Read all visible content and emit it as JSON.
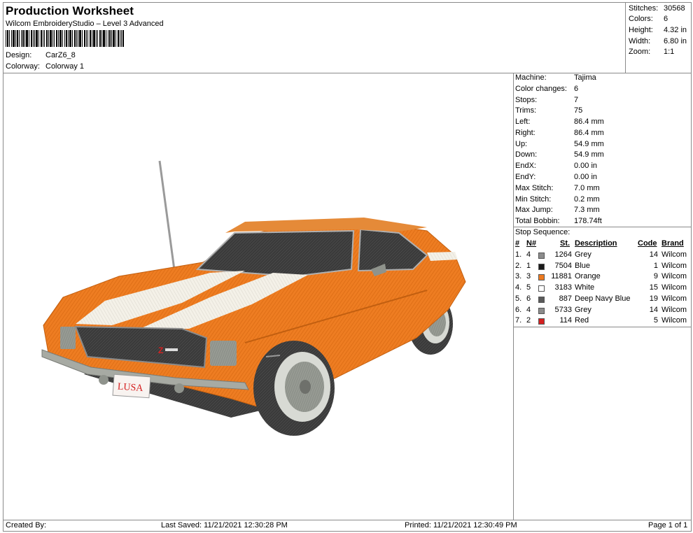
{
  "header": {
    "title": "Production Worksheet",
    "subtitle": "Wilcom EmbroideryStudio – Level 3 Advanced",
    "design_label": "Design:",
    "design_value": "CarZ6_8",
    "colorway_label": "Colorway:",
    "colorway_value": "Colorway 1"
  },
  "summary": [
    {
      "label": "Stitches:",
      "value": "30568"
    },
    {
      "label": "Colors:",
      "value": "6"
    },
    {
      "label": "Height:",
      "value": "4.32 in"
    },
    {
      "label": "Width:",
      "value": "6.80 in"
    },
    {
      "label": "Zoom:",
      "value": "1:1"
    }
  ],
  "machine_info": [
    {
      "label": "Machine:",
      "value": "Tajima"
    },
    {
      "label": "Color changes:",
      "value": "6"
    },
    {
      "label": "Stops:",
      "value": "7"
    },
    {
      "label": "Trims:",
      "value": "75"
    },
    {
      "label": "Left:",
      "value": "86.4 mm"
    },
    {
      "label": "Right:",
      "value": "86.4 mm"
    },
    {
      "label": "Up:",
      "value": "54.9 mm"
    },
    {
      "label": "Down:",
      "value": "54.9 mm"
    },
    {
      "label": "EndX:",
      "value": "0.00 in"
    },
    {
      "label": "EndY:",
      "value": "0.00 in"
    },
    {
      "label": "Max Stitch:",
      "value": "7.0 mm"
    },
    {
      "label": "Min Stitch:",
      "value": "0.2 mm"
    },
    {
      "label": "Max Jump:",
      "value": "7.3 mm"
    },
    {
      "label": "Total Bobbin:",
      "value": "178.74ft"
    }
  ],
  "stop_sequence": {
    "title": "Stop Sequence:",
    "headers": {
      "num": "#",
      "n": "N#",
      "st": "St.",
      "desc": "Description",
      "code": "Code",
      "brand": "Brand"
    },
    "rows": [
      {
        "num": "1.",
        "n": "4",
        "color": "#8c8c8c",
        "st": "1264",
        "desc": "Grey",
        "code": "14",
        "brand": "Wilcom"
      },
      {
        "num": "2.",
        "n": "1",
        "color": "#1a1a1a",
        "st": "7504",
        "desc": "Blue",
        "code": "1",
        "brand": "Wilcom"
      },
      {
        "num": "3.",
        "n": "3",
        "color": "#ee7a1f",
        "st": "11881",
        "desc": "Orange",
        "code": "9",
        "brand": "Wilcom"
      },
      {
        "num": "4.",
        "n": "5",
        "color": "#ffffff",
        "st": "3183",
        "desc": "White",
        "code": "15",
        "brand": "Wilcom"
      },
      {
        "num": "5.",
        "n": "6",
        "color": "#5a5a5a",
        "st": "887",
        "desc": "Deep Navy Blue",
        "code": "19",
        "brand": "Wilcom"
      },
      {
        "num": "6.",
        "n": "4",
        "color": "#8c8c8c",
        "st": "5733",
        "desc": "Grey",
        "code": "14",
        "brand": "Wilcom"
      },
      {
        "num": "7.",
        "n": "2",
        "color": "#d42020",
        "st": "114",
        "desc": "Red",
        "code": "5",
        "brand": "Wilcom"
      }
    ]
  },
  "design_preview": {
    "plate_text": "LUSA"
  },
  "footer": {
    "created_by": "Created By:",
    "last_saved": "Last Saved: 11/21/2021 12:30:28 PM",
    "printed": "Printed: 11/21/2021 12:30:49 PM",
    "page": "Page 1 of 1"
  }
}
